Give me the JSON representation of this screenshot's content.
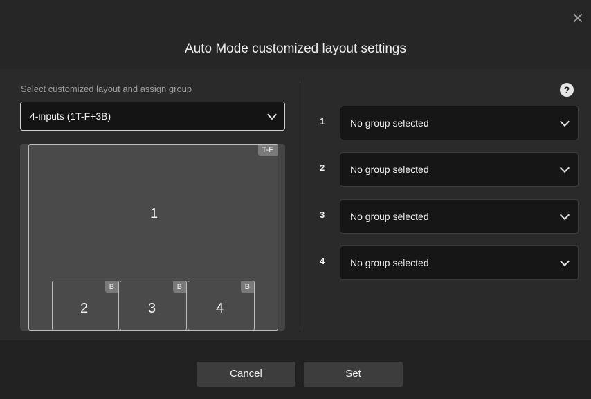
{
  "dialog": {
    "title": "Auto Mode customized layout settings",
    "close_glyph": "✕"
  },
  "left": {
    "label": "Select customized layout and assign group",
    "layout_select": {
      "value": "4-inputs (1T-F+3B)"
    },
    "preview": {
      "main": {
        "number": "1",
        "badge": "T-F"
      },
      "tiles": [
        {
          "number": "2",
          "badge": "B"
        },
        {
          "number": "3",
          "badge": "B"
        },
        {
          "number": "4",
          "badge": "B"
        }
      ]
    }
  },
  "right": {
    "help_glyph": "?",
    "groups": [
      {
        "index": "1",
        "value": "No group selected"
      },
      {
        "index": "2",
        "value": "No group selected"
      },
      {
        "index": "3",
        "value": "No group selected"
      },
      {
        "index": "4",
        "value": "No group selected"
      }
    ]
  },
  "footer": {
    "cancel_label": "Cancel",
    "set_label": "Set"
  },
  "icons": [
    "close-icon",
    "chevron-down-icon",
    "help-icon"
  ]
}
